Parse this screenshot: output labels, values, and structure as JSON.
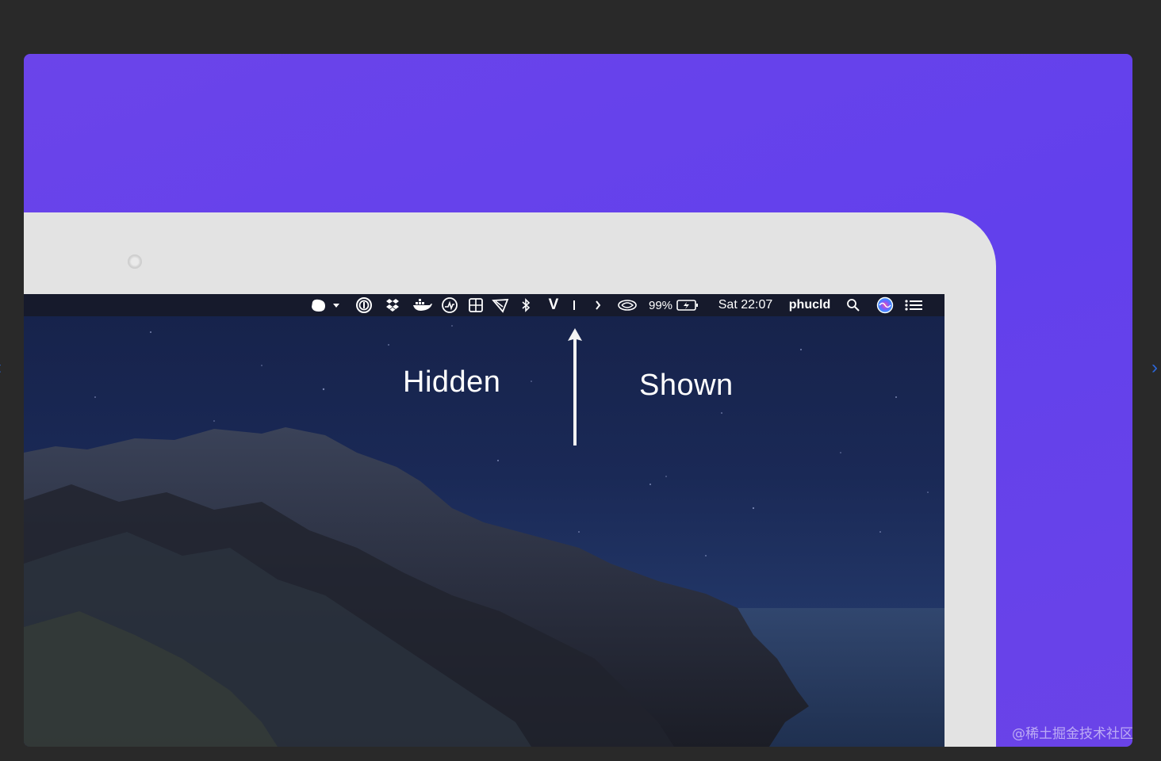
{
  "colors": {
    "background": "#292929",
    "card": "#6340ec",
    "laptop_bezel": "#e3e3e3",
    "menubar": "#161a2c",
    "text": "#ffffff"
  },
  "menubar": {
    "status_icons": [
      "blob-dropdown-icon",
      "onepassword-icon",
      "dropbox-icon",
      "docker-icon",
      "istat-activity-icon",
      "grid-tool-icon",
      "screenshot-pen-icon",
      "bluetooth-icon",
      "vimac-v-icon",
      "divider-bar-icon",
      "chevron-right-icon",
      "cloud-sync-icon"
    ],
    "battery_percent": "99%",
    "battery_icon": "battery-charging-icon",
    "clock": "Sat 22:07",
    "username": "phucld",
    "spotlight_icon": "search-icon",
    "siri_icon": "siri-icon",
    "notification_icon": "list-icon"
  },
  "annotations": {
    "hidden_label": "Hidden",
    "shown_label": "Shown"
  },
  "watermark": "@稀土掘金技术社区"
}
